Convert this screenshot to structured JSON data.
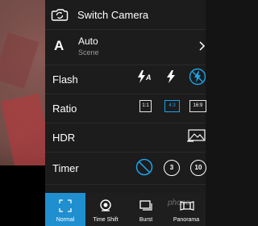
{
  "panel": {
    "switch_camera": "Switch Camera",
    "scene": {
      "icon_letter": "A",
      "title": "Auto",
      "subtitle": "Scene"
    },
    "flash": {
      "label": "Flash",
      "options": [
        "auto",
        "on",
        "off"
      ],
      "selected": "off"
    },
    "ratio": {
      "label": "Ratio",
      "options": [
        "1:1",
        "4:3",
        "16:9"
      ],
      "selected": "4:3"
    },
    "hdr": {
      "label": "HDR"
    },
    "timer": {
      "label": "Timer",
      "options": [
        "off",
        "3",
        "10"
      ],
      "selected": "off"
    }
  },
  "modes": {
    "items": [
      "Normal",
      "Time Shift",
      "Burst",
      "Panorama"
    ],
    "selected": "Normal"
  },
  "watermark": "phone",
  "colors": {
    "accent": "#1aa3e8",
    "panel_bg": "#1c1c1c",
    "mode_selected": "#1f8fd0"
  }
}
